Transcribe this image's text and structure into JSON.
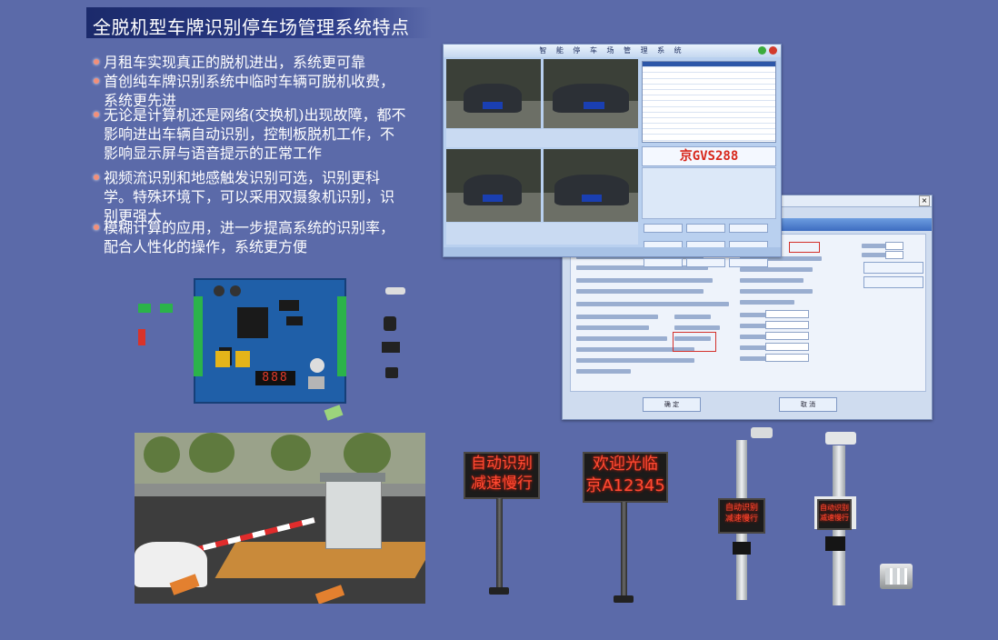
{
  "title": "全脱机型车牌识别停车场管理系统特点",
  "bullets": [
    "月租车实现真正的脱机进出，系统更可靠",
    "首创纯车牌识别系统中临时车辆可脱机收费，系统更先进",
    "无论是计算机还是网络(交换机)出现故障，都不影响进出车辆自动识别，控制板脱机工作，不影响显示屏与语音提示的正常工作",
    "视频流识别和地感触发识别可选，识别更科学。特殊环境下，可以采用双摄象机识别，识别更强大",
    "模糊计算的应用，进一步提高系统的识别率，配合人性化的操作，系统更方便"
  ],
  "software_window": {
    "title": "智 能 停 车 场 管 理 系 统",
    "plate_number": "京GVS288"
  },
  "settings_window": {
    "ok_label": "确 定",
    "cancel_label": "取 消"
  },
  "led_signs": {
    "sign1": [
      "自动识别",
      "减速慢行"
    ],
    "sign2": [
      "欢迎光临",
      "京A12345"
    ],
    "sign3": [
      "自动识别",
      "减速慢行"
    ],
    "sign4": [
      "自动识别",
      "减速慢行"
    ]
  },
  "colors": {
    "background": "#5b6aa9",
    "bullet_dot": "#f28f7a",
    "led_red": "#ff4a33"
  }
}
